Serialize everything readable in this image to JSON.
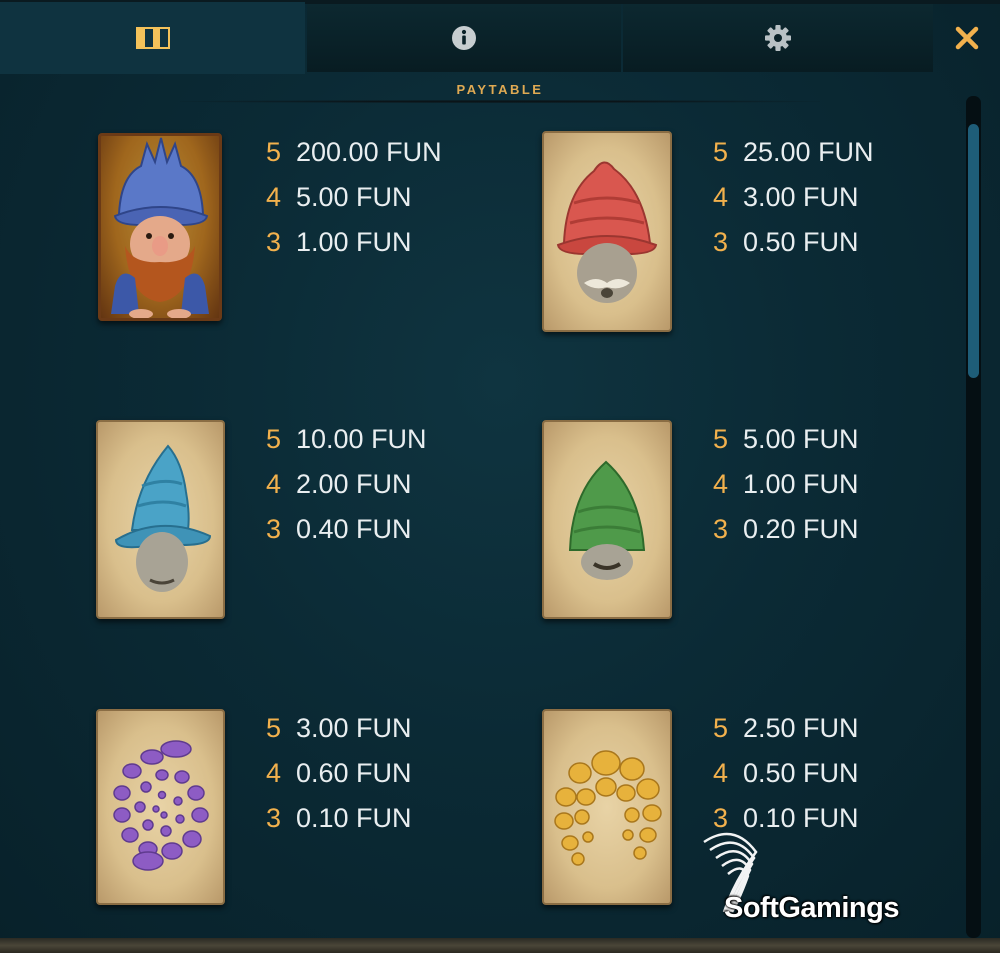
{
  "tabs": [
    {
      "id": "paytable",
      "icon": "checker-icon",
      "active": true
    },
    {
      "id": "info",
      "icon": "info-icon",
      "active": false
    },
    {
      "id": "settings",
      "icon": "gear-icon",
      "active": false
    }
  ],
  "close_icon": "close-icon",
  "heading": "PAYTABLE",
  "colors": {
    "accent": "#f2b14d",
    "panel": "#0b2a35",
    "text": "#e9eef0",
    "scroll_thumb": "#1e5d78"
  },
  "symbols": [
    {
      "name": "blue-shell-dwarf",
      "pays": [
        {
          "count": "5",
          "amount": "200.00 FUN"
        },
        {
          "count": "4",
          "amount": "5.00 FUN"
        },
        {
          "count": "3",
          "amount": "1.00 FUN"
        }
      ]
    },
    {
      "name": "red-hat-gnome",
      "pays": [
        {
          "count": "5",
          "amount": "25.00 FUN"
        },
        {
          "count": "4",
          "amount": "3.00 FUN"
        },
        {
          "count": "3",
          "amount": "0.50 FUN"
        }
      ]
    },
    {
      "name": "blue-hat-gnome",
      "pays": [
        {
          "count": "5",
          "amount": "10.00 FUN"
        },
        {
          "count": "4",
          "amount": "2.00 FUN"
        },
        {
          "count": "3",
          "amount": "0.40 FUN"
        }
      ]
    },
    {
      "name": "green-hat-gnome",
      "pays": [
        {
          "count": "5",
          "amount": "5.00 FUN"
        },
        {
          "count": "4",
          "amount": "1.00 FUN"
        },
        {
          "count": "3",
          "amount": "0.20 FUN"
        }
      ]
    },
    {
      "name": "purple-spiral",
      "pays": [
        {
          "count": "5",
          "amount": "3.00 FUN"
        },
        {
          "count": "4",
          "amount": "0.60 FUN"
        },
        {
          "count": "3",
          "amount": "0.10 FUN"
        }
      ]
    },
    {
      "name": "gold-horseshoe",
      "pays": [
        {
          "count": "5",
          "amount": "2.50 FUN"
        },
        {
          "count": "4",
          "amount": "0.50 FUN"
        },
        {
          "count": "3",
          "amount": "0.10 FUN"
        }
      ]
    }
  ],
  "watermark": "SoftGamings"
}
